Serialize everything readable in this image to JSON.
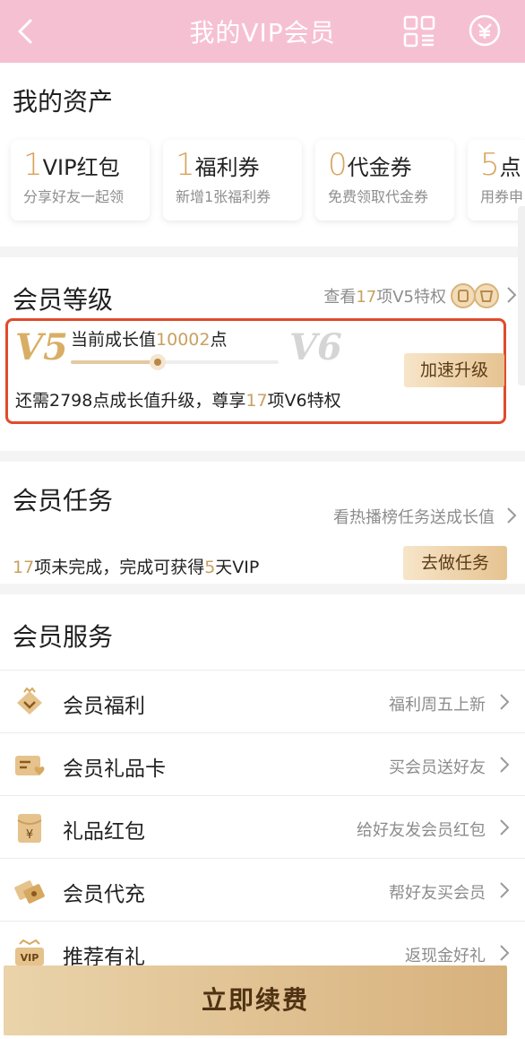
{
  "header": {
    "title": "我的VIP会员"
  },
  "assets": {
    "title": "我的资产",
    "cards": [
      {
        "num": "1",
        "label": "VIP红包",
        "desc": "分享好友一起领"
      },
      {
        "num": "1",
        "label": "福利券",
        "desc": "新增1张福利券"
      },
      {
        "num": "0",
        "label": "代金券",
        "desc": "免费领取代金券"
      },
      {
        "num": "5",
        "label": "点",
        "desc": "用券申"
      }
    ]
  },
  "level": {
    "title": "会员等级",
    "link_prefix": "查看",
    "link_count": "17",
    "link_suffix": "项V5特权",
    "current_level": "V5",
    "next_level": "V6",
    "growth_label": "当前成长值",
    "growth_value": "10002",
    "growth_unit": "点",
    "progress": 0.42,
    "speed_button": "加速升级",
    "need_prefix": "还需2798点成长值升级，尊享",
    "need_count": "17",
    "need_suffix": "项V6特权"
  },
  "task": {
    "title": "会员任务",
    "link": "看热播榜任务送成长值",
    "text_count1": "17",
    "text_mid": "项未完成，完成可获得",
    "text_count2": "5",
    "text_suffix": "天VIP",
    "button": "去做任务"
  },
  "service": {
    "title": "会员服务",
    "items": [
      {
        "icon": "crown-icon",
        "label": "会员福利",
        "desc": "福利周五上新"
      },
      {
        "icon": "gift-card-icon",
        "label": "会员礼品卡",
        "desc": "买会员送好友"
      },
      {
        "icon": "red-envelope-icon",
        "label": "礼品红包",
        "desc": "给好友发会员红包"
      },
      {
        "icon": "ticket-icon",
        "label": "会员代充",
        "desc": "帮好友买会员"
      },
      {
        "icon": "vip-badge-icon",
        "label": "推荐有礼",
        "desc": "返现金好礼"
      }
    ]
  },
  "renew_button": "立即续费",
  "colors": {
    "header": "#f6c0d3",
    "gold": "#c9a060",
    "highlight_border": "#e04b2c"
  }
}
